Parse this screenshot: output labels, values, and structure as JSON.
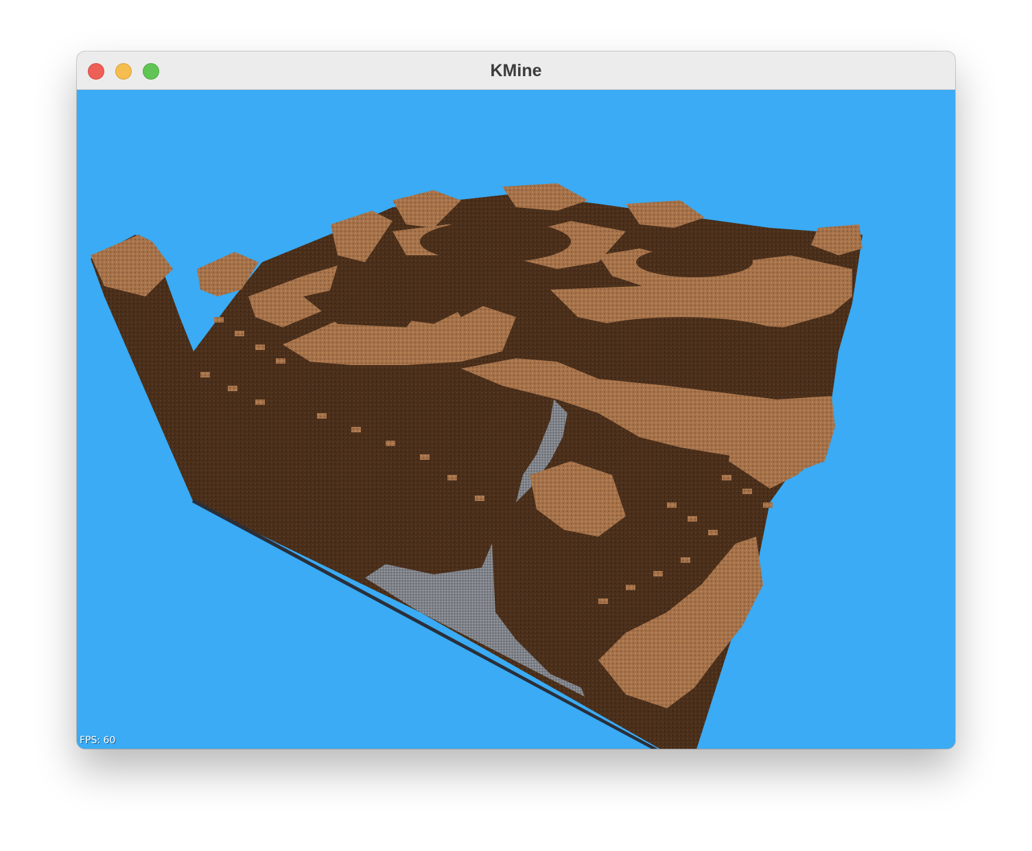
{
  "window": {
    "title": "KMine"
  },
  "titlebar": {
    "buttons": [
      "close",
      "minimize",
      "zoom"
    ]
  },
  "viewport": {
    "sky_color": "#3aabf4",
    "fps_label": "FPS: 60"
  },
  "colors": {
    "dirt_top": "#a5724a",
    "dirt_side": "#4a2f1b",
    "dirt_dark": "#3a2413",
    "stone": "#8a8d92",
    "bottom_edge": "#2a2f3a"
  }
}
